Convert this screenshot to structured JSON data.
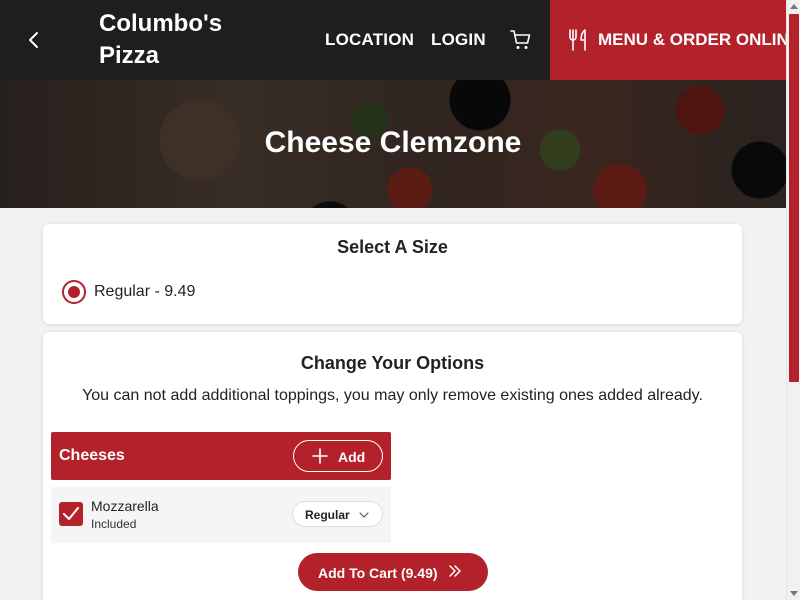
{
  "header": {
    "brand": "Columbo's Pizza",
    "nav": {
      "location": "LOCATION",
      "login": "LOGIN"
    },
    "order_button": "MENU & ORDER ONLINE",
    "icons": {
      "back": "chevron-left-icon",
      "cart": "cart-icon",
      "order": "fork-knife-icon"
    }
  },
  "hero": {
    "title": "Cheese Clemzone"
  },
  "size_section": {
    "title": "Select A Size",
    "options": [
      {
        "label": "Regular - 9.49",
        "selected": true
      }
    ]
  },
  "options_section": {
    "title": "Change Your Options",
    "note": "You can not add additional toppings, you may only remove existing ones added already.",
    "groups": [
      {
        "title": "Cheeses",
        "add_label": "Add",
        "items": [
          {
            "name": "Mozzarella",
            "status": "Included",
            "checked": true,
            "amount": "Regular"
          }
        ]
      }
    ]
  },
  "cart_button": {
    "label": "Add To Cart (9.49)"
  },
  "colors": {
    "accent": "#b3212b",
    "header_bg": "#1e1e1e",
    "page_bg": "#f2f2f2"
  }
}
